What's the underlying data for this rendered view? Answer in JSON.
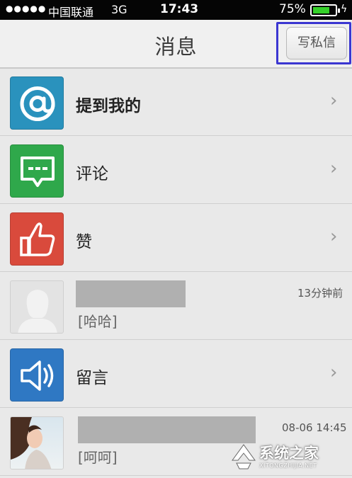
{
  "status_bar": {
    "signal": "●●●●●",
    "carrier": "中国联通",
    "network": "3G",
    "time": "17:43",
    "battery_percent": "75%",
    "battery_level": 0.75
  },
  "header": {
    "title": "消息",
    "write_button_label": "写私信"
  },
  "rows": [
    {
      "type": "category",
      "label": "提到我的",
      "icon": "at-sign-icon",
      "color": "#2a92bd"
    },
    {
      "type": "category",
      "label": "评论",
      "icon": "comment-bubble-icon",
      "color": "#2fa84b"
    },
    {
      "type": "category",
      "label": "赞",
      "icon": "thumbs-up-icon",
      "color": "#d94a3c"
    },
    {
      "type": "message",
      "time": "13分钟前",
      "message": "[哈哈]",
      "avatar": "default-avatar-icon"
    },
    {
      "type": "category",
      "label": "留言",
      "icon": "speaker-icon",
      "color": "#2f78c3"
    },
    {
      "type": "message",
      "time": "08-06 14:45",
      "message": "[呵呵]",
      "avatar": "user-photo"
    }
  ],
  "watermark": {
    "title": "系统之家",
    "subtitle": "XITONGZHIJIA.NET"
  }
}
